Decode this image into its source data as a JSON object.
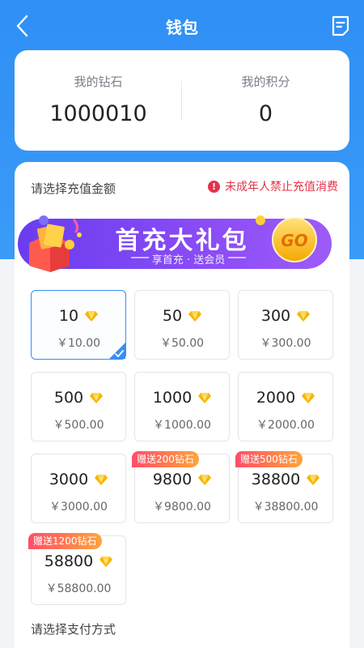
{
  "navbar": {
    "title": "钱包"
  },
  "balance": {
    "diamond_label": "我的钻石",
    "diamond_value": "1000010",
    "points_label": "我的积分",
    "points_value": "0"
  },
  "recharge": {
    "title": "请选择充值金额",
    "warning": "未成年人禁止充值消费"
  },
  "banner": {
    "title": "首充大礼包",
    "subtitle": "享首充 · 送会员",
    "go_label": "GO"
  },
  "packages": [
    {
      "amount": "10",
      "price": "￥10.00",
      "selected": true
    },
    {
      "amount": "50",
      "price": "￥50.00"
    },
    {
      "amount": "300",
      "price": "￥300.00"
    },
    {
      "amount": "500",
      "price": "￥500.00"
    },
    {
      "amount": "1000",
      "price": "￥1000.00"
    },
    {
      "amount": "2000",
      "price": "￥2000.00"
    },
    {
      "amount": "3000",
      "price": "￥3000.00"
    },
    {
      "amount": "9800",
      "price": "￥9800.00",
      "bonus": "赠送200钻石"
    },
    {
      "amount": "38800",
      "price": "￥38800.00",
      "bonus": "赠送500钻石"
    },
    {
      "amount": "58800",
      "price": "￥58800.00",
      "bonus": "赠送1200钻石"
    }
  ],
  "payment": {
    "title": "请选择支付方式"
  },
  "colors": {
    "primary": "#3a8ef0",
    "warning": "#e2344a",
    "gem": "#f5b800"
  }
}
